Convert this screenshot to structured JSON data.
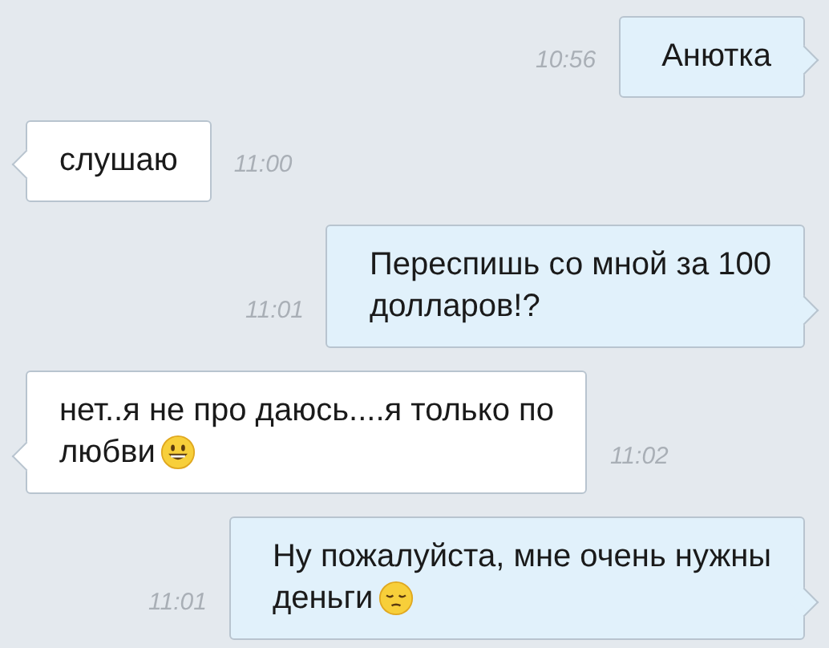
{
  "messages": [
    {
      "kind": "outgoing",
      "lines": [
        "Анютка"
      ],
      "time": "10:56"
    },
    {
      "kind": "incoming",
      "lines": [
        "слушаю"
      ],
      "time": "11:00"
    },
    {
      "kind": "outgoing",
      "lines": [
        "Переспишь со мной за 100",
        "долларов!?"
      ],
      "time": "11:01"
    },
    {
      "kind": "incoming",
      "lines": [
        "нет..я не про даюсь....я только по",
        "любви"
      ],
      "emoji": {
        "kind": "smile"
      },
      "time": "11:02"
    },
    {
      "kind": "outgoing",
      "lines": [
        "Ну пожалуйста, мне очень нужны",
        "деньги"
      ],
      "emoji": {
        "kind": "sad"
      },
      "time": "11:01"
    }
  ]
}
